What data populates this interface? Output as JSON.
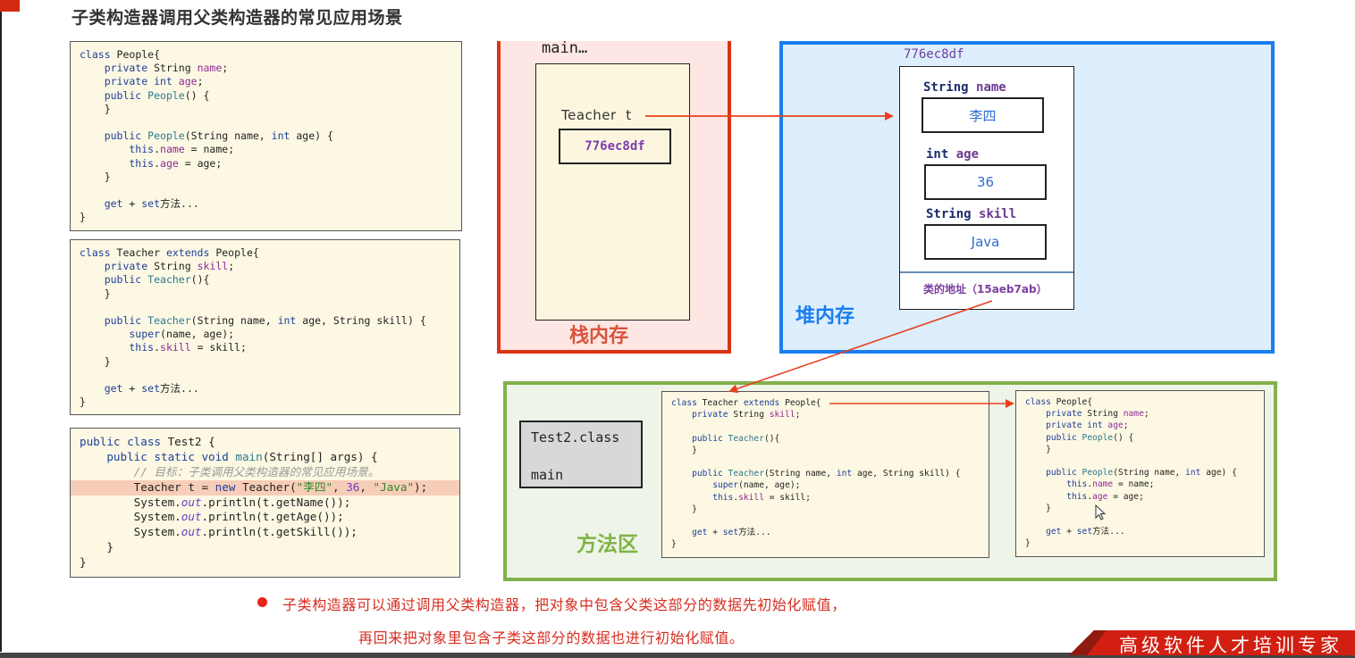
{
  "slide": {
    "title": "子类构造器调用父类构造器的常见应用场景"
  },
  "code_panels": {
    "people": {
      "lines": [
        [
          {
            "t": "class ",
            "c": "kw"
          },
          {
            "t": "People{",
            "c": ""
          }
        ],
        [
          {
            "t": "    private ",
            "c": "kw"
          },
          {
            "t": "String ",
            "c": ""
          },
          {
            "t": "name",
            "c": "fld"
          },
          {
            "t": ";",
            "c": ""
          }
        ],
        [
          {
            "t": "    private int ",
            "c": "kw"
          },
          {
            "t": "age",
            "c": "fld"
          },
          {
            "t": ";",
            "c": ""
          }
        ],
        [
          {
            "t": "    public ",
            "c": "kw"
          },
          {
            "t": "People",
            "c": "fn"
          },
          {
            "t": "() {",
            "c": ""
          }
        ],
        [
          {
            "t": "    }",
            "c": ""
          }
        ],
        [
          {
            "t": "",
            "c": ""
          }
        ],
        [
          {
            "t": "    public ",
            "c": "kw"
          },
          {
            "t": "People",
            "c": "fn"
          },
          {
            "t": "(String name, ",
            "c": ""
          },
          {
            "t": "int ",
            "c": "kw"
          },
          {
            "t": "age) {",
            "c": ""
          }
        ],
        [
          {
            "t": "        this",
            "c": "kw"
          },
          {
            "t": ".",
            "c": ""
          },
          {
            "t": "name",
            "c": "fld"
          },
          {
            "t": " = name;",
            "c": ""
          }
        ],
        [
          {
            "t": "        this",
            "c": "kw"
          },
          {
            "t": ".",
            "c": ""
          },
          {
            "t": "age",
            "c": "fld"
          },
          {
            "t": " = age;",
            "c": ""
          }
        ],
        [
          {
            "t": "    }",
            "c": ""
          }
        ],
        [
          {
            "t": "",
            "c": ""
          }
        ],
        [
          {
            "t": "    get",
            "c": "kw"
          },
          {
            "t": " + ",
            "c": ""
          },
          {
            "t": "set",
            "c": "kw"
          },
          {
            "t": "方法...",
            "c": ""
          }
        ],
        [
          {
            "t": "}",
            "c": ""
          }
        ]
      ]
    },
    "teacher": {
      "lines": [
        [
          {
            "t": "class ",
            "c": "kw"
          },
          {
            "t": "Teacher ",
            "c": ""
          },
          {
            "t": "extends ",
            "c": "kw"
          },
          {
            "t": "People{",
            "c": ""
          }
        ],
        [
          {
            "t": "    private ",
            "c": "kw"
          },
          {
            "t": "String ",
            "c": ""
          },
          {
            "t": "skill",
            "c": "fld"
          },
          {
            "t": ";",
            "c": ""
          }
        ],
        [
          {
            "t": "    public ",
            "c": "kw"
          },
          {
            "t": "Teacher",
            "c": "fn"
          },
          {
            "t": "(){",
            "c": ""
          }
        ],
        [
          {
            "t": "    }",
            "c": ""
          }
        ],
        [
          {
            "t": "",
            "c": ""
          }
        ],
        [
          {
            "t": "    public ",
            "c": "kw"
          },
          {
            "t": "Teacher",
            "c": "fn"
          },
          {
            "t": "(String name, ",
            "c": ""
          },
          {
            "t": "int ",
            "c": "kw"
          },
          {
            "t": "age, String skill) {",
            "c": ""
          }
        ],
        [
          {
            "t": "        super",
            "c": "kw"
          },
          {
            "t": "(name, age);",
            "c": ""
          }
        ],
        [
          {
            "t": "        this",
            "c": "kw"
          },
          {
            "t": ".",
            "c": ""
          },
          {
            "t": "skill",
            "c": "fld"
          },
          {
            "t": " = skill;",
            "c": ""
          }
        ],
        [
          {
            "t": "    }",
            "c": ""
          }
        ],
        [
          {
            "t": "",
            "c": ""
          }
        ],
        [
          {
            "t": "    get",
            "c": "kw"
          },
          {
            "t": " + ",
            "c": ""
          },
          {
            "t": "set",
            "c": "kw"
          },
          {
            "t": "方法...",
            "c": ""
          }
        ],
        [
          {
            "t": "}",
            "c": ""
          }
        ]
      ]
    },
    "test2": {
      "highlight_line": 3,
      "lines": [
        [
          {
            "t": "public class ",
            "c": "kw"
          },
          {
            "t": "Test2 {",
            "c": ""
          }
        ],
        [
          {
            "t": "    public static void ",
            "c": "kw"
          },
          {
            "t": "main",
            "c": "fn"
          },
          {
            "t": "(String[] args) {",
            "c": ""
          }
        ],
        [
          {
            "t": "        // 目标：子类调用父类构造器的常见应用场景。",
            "c": "cm"
          }
        ],
        [
          {
            "t": "        Teacher t = ",
            "c": ""
          },
          {
            "t": "new ",
            "c": "kw"
          },
          {
            "t": "Teacher(",
            "c": ""
          },
          {
            "t": "\"李四\"",
            "c": "str"
          },
          {
            "t": ", ",
            "c": ""
          },
          {
            "t": "36",
            "c": "num"
          },
          {
            "t": ", ",
            "c": ""
          },
          {
            "t": "\"Java\"",
            "c": "str"
          },
          {
            "t": ");",
            "c": ""
          }
        ],
        [
          {
            "t": "        System.",
            "c": ""
          },
          {
            "t": "out",
            "c": "outit"
          },
          {
            "t": ".println(t.getName());",
            "c": ""
          }
        ],
        [
          {
            "t": "        System.",
            "c": ""
          },
          {
            "t": "out",
            "c": "outit"
          },
          {
            "t": ".println(t.getAge());",
            "c": ""
          }
        ],
        [
          {
            "t": "        System.",
            "c": ""
          },
          {
            "t": "out",
            "c": "outit"
          },
          {
            "t": ".println(t.getSkill());",
            "c": ""
          }
        ],
        [
          {
            "t": "    }",
            "c": ""
          }
        ],
        [
          {
            "t": "}",
            "c": ""
          }
        ]
      ]
    },
    "method_teacher": {
      "lines": [
        [
          {
            "t": "class ",
            "c": "kw"
          },
          {
            "t": "Teacher ",
            "c": ""
          },
          {
            "t": "extends ",
            "c": "kw"
          },
          {
            "t": "People{",
            "c": ""
          }
        ],
        [
          {
            "t": "    private ",
            "c": "kw"
          },
          {
            "t": "String ",
            "c": ""
          },
          {
            "t": "skill",
            "c": "fld"
          },
          {
            "t": ";",
            "c": ""
          }
        ],
        [
          {
            "t": "",
            "c": ""
          }
        ],
        [
          {
            "t": "    public ",
            "c": "kw"
          },
          {
            "t": "Teacher",
            "c": "fn"
          },
          {
            "t": "(){",
            "c": ""
          }
        ],
        [
          {
            "t": "    }",
            "c": ""
          }
        ],
        [
          {
            "t": "",
            "c": ""
          }
        ],
        [
          {
            "t": "    public ",
            "c": "kw"
          },
          {
            "t": "Teacher",
            "c": "fn"
          },
          {
            "t": "(String name, ",
            "c": ""
          },
          {
            "t": "int ",
            "c": "kw"
          },
          {
            "t": "age, String skill) {",
            "c": ""
          }
        ],
        [
          {
            "t": "        super",
            "c": "kw"
          },
          {
            "t": "(name, age);",
            "c": ""
          }
        ],
        [
          {
            "t": "        this",
            "c": "kw"
          },
          {
            "t": ".",
            "c": ""
          },
          {
            "t": "skill",
            "c": "fld"
          },
          {
            "t": " = skill;",
            "c": ""
          }
        ],
        [
          {
            "t": "    }",
            "c": ""
          }
        ],
        [
          {
            "t": "",
            "c": ""
          }
        ],
        [
          {
            "t": "    get",
            "c": "kw"
          },
          {
            "t": " + ",
            "c": ""
          },
          {
            "t": "set",
            "c": "kw"
          },
          {
            "t": "方法...",
            "c": ""
          }
        ],
        [
          {
            "t": "}",
            "c": ""
          }
        ]
      ]
    },
    "method_people": {
      "lines": [
        [
          {
            "t": "class ",
            "c": "kw"
          },
          {
            "t": "People{",
            "c": ""
          }
        ],
        [
          {
            "t": "    private ",
            "c": "kw"
          },
          {
            "t": "String ",
            "c": ""
          },
          {
            "t": "name",
            "c": "fld"
          },
          {
            "t": ";",
            "c": ""
          }
        ],
        [
          {
            "t": "    private int ",
            "c": "kw"
          },
          {
            "t": "age",
            "c": "fld"
          },
          {
            "t": ";",
            "c": ""
          }
        ],
        [
          {
            "t": "    public ",
            "c": "kw"
          },
          {
            "t": "People",
            "c": "fn"
          },
          {
            "t": "() {",
            "c": ""
          }
        ],
        [
          {
            "t": "    }",
            "c": ""
          }
        ],
        [
          {
            "t": "",
            "c": ""
          }
        ],
        [
          {
            "t": "    public ",
            "c": "kw"
          },
          {
            "t": "People",
            "c": "fn"
          },
          {
            "t": "(String name, ",
            "c": ""
          },
          {
            "t": "int ",
            "c": "kw"
          },
          {
            "t": "age) {",
            "c": ""
          }
        ],
        [
          {
            "t": "        this",
            "c": "kw"
          },
          {
            "t": ".",
            "c": ""
          },
          {
            "t": "name",
            "c": "fld"
          },
          {
            "t": " = name;",
            "c": ""
          }
        ],
        [
          {
            "t": "        this",
            "c": "kw"
          },
          {
            "t": ".",
            "c": ""
          },
          {
            "t": "age",
            "c": "fld"
          },
          {
            "t": " = age;",
            "c": ""
          }
        ],
        [
          {
            "t": "    }",
            "c": ""
          }
        ],
        [
          {
            "t": "",
            "c": ""
          }
        ],
        [
          {
            "t": "    get",
            "c": "kw"
          },
          {
            "t": " + ",
            "c": ""
          },
          {
            "t": "set",
            "c": "kw"
          },
          {
            "t": "方法...",
            "c": ""
          }
        ],
        [
          {
            "t": "}",
            "c": ""
          }
        ]
      ]
    }
  },
  "stack": {
    "title": "栈内存",
    "frame_label": "main…",
    "var_label": "Teacher  t",
    "var_value": "776ec8df"
  },
  "heap": {
    "title": "堆内存",
    "object_address": "776ec8df",
    "fields": [
      {
        "type": "String",
        "name": "name",
        "value": "李四"
      },
      {
        "type": "int",
        "name": "age",
        "value": "36"
      },
      {
        "type": "String",
        "name": "skill",
        "value": "Java"
      }
    ],
    "class_address_label": "类的地址（15aeb7ab）"
  },
  "method_area": {
    "title": "方法区",
    "test2_class": "Test2.class",
    "test2_method": "main"
  },
  "notes": {
    "line1": "子类构造器可以通过调用父类构造器，把对象中包含父类这部分的数据先初始化赋值，",
    "line2": "再回来把对象里包含子类这部分的数据也进行初始化赋值。"
  },
  "brand": {
    "slogan": "高级软件人才培训专家"
  },
  "colors": {
    "stack_border": "#d93416",
    "heap_border": "#1a7ef0",
    "method_border": "#82b14a",
    "arrow": "#e8401e",
    "note_text": "#d72d1f",
    "brand_red": "#d21f12"
  }
}
